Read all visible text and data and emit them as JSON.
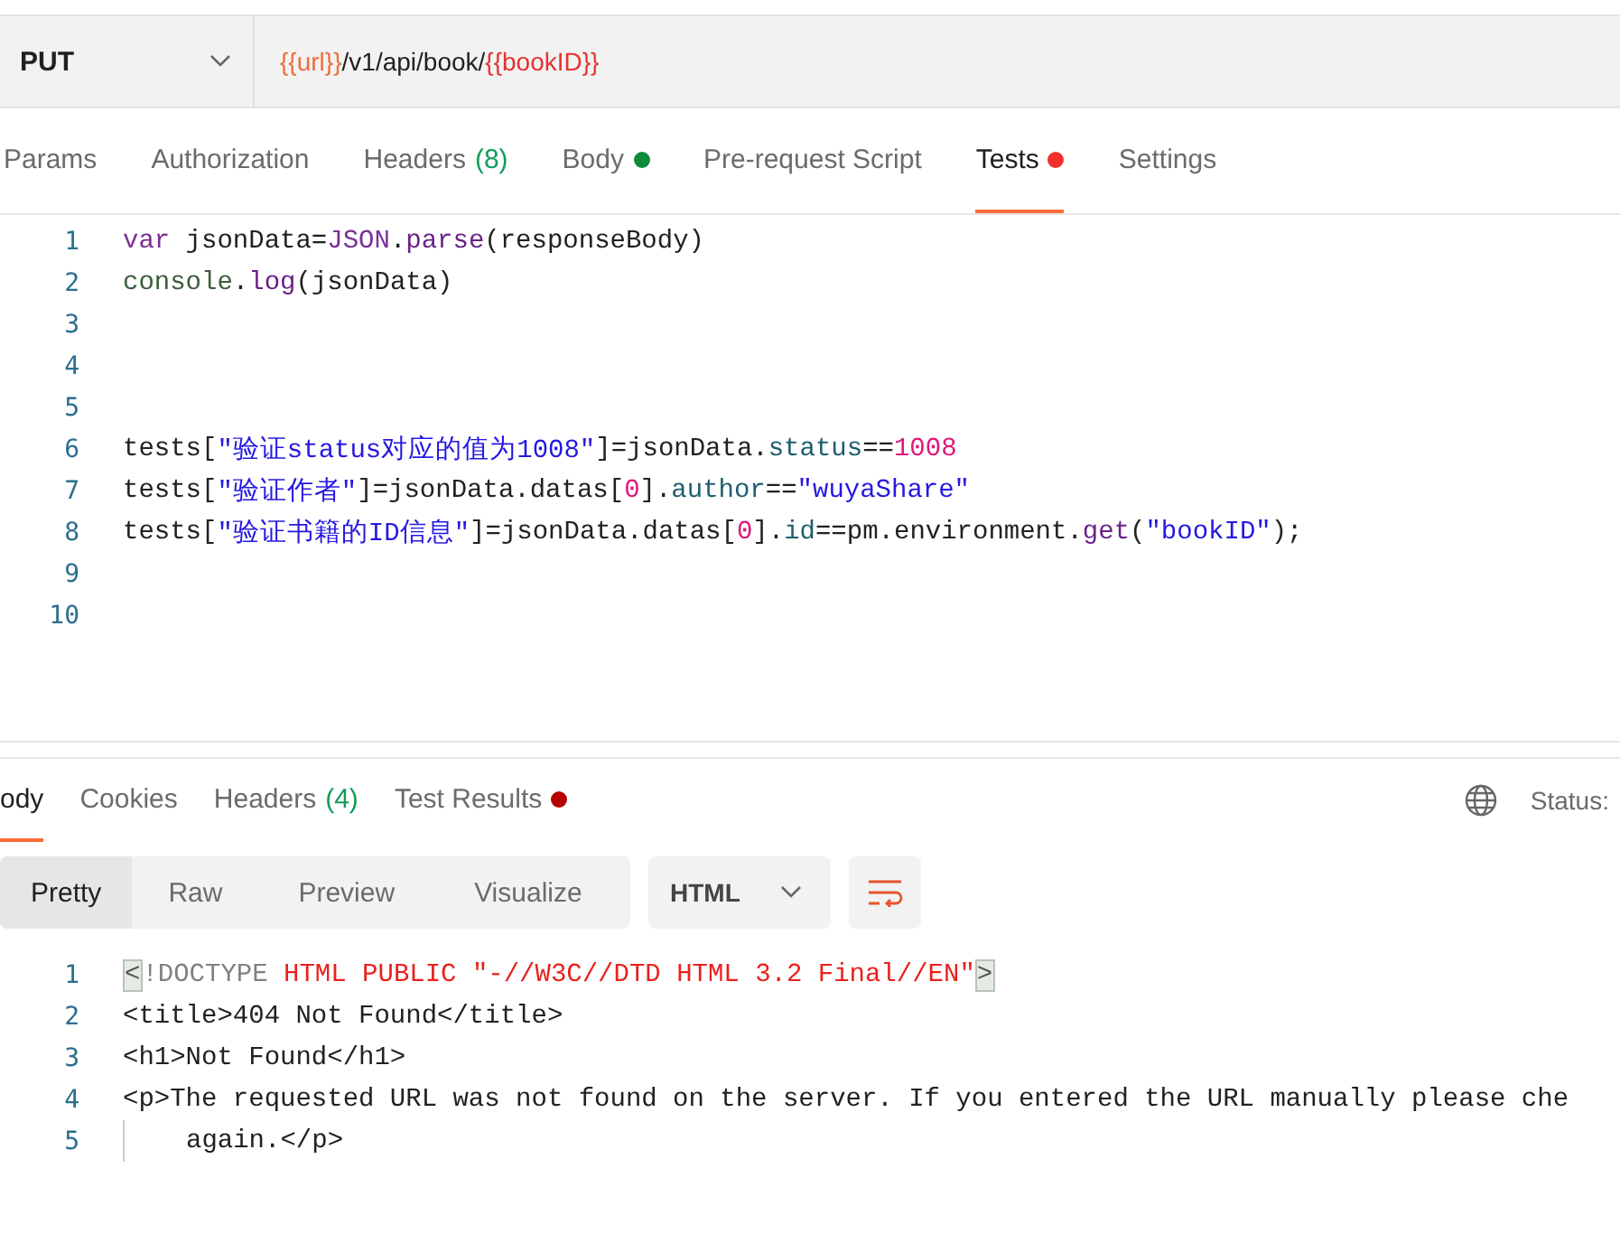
{
  "request": {
    "method": "PUT",
    "url": [
      {
        "kind": "var",
        "text": "{{url}}"
      },
      {
        "kind": "plain",
        "text": "/v1/api/book/"
      },
      {
        "kind": "var2",
        "text": "{{bookID}}"
      }
    ]
  },
  "request_tabs": [
    {
      "label": "Params",
      "selected": false
    },
    {
      "label": "Authorization",
      "selected": false
    },
    {
      "label": "Headers",
      "count": "(8)",
      "selected": false
    },
    {
      "label": "Body",
      "dot": true,
      "color": "#0f8a3c",
      "selected": false
    },
    {
      "label": "Pre-request Script",
      "selected": false
    },
    {
      "label": "Tests",
      "dot": true,
      "color": "#f0302a",
      "selected": true
    },
    {
      "label": "Settings",
      "selected": false
    }
  ],
  "script_lines": [
    {
      "number": "1",
      "tokens": [
        {
          "kind": "keyword",
          "text": "var"
        },
        {
          "kind": "plain",
          "text": " jsonData="
        },
        {
          "kind": "keyword",
          "text": "JSON"
        },
        {
          "kind": "plain",
          "text": "."
        },
        {
          "kind": "func",
          "text": "parse"
        },
        {
          "kind": "plain",
          "text": "(responseBody)"
        }
      ]
    },
    {
      "number": "2",
      "tokens": [
        {
          "kind": "object",
          "text": "console"
        },
        {
          "kind": "plain",
          "text": "."
        },
        {
          "kind": "func",
          "text": "log"
        },
        {
          "kind": "plain",
          "text": "(jsonData)"
        }
      ]
    },
    {
      "number": "3"
    },
    {
      "number": "4"
    },
    {
      "number": "5"
    },
    {
      "number": "6",
      "tokens": [
        {
          "kind": "plain",
          "text": "tests["
        },
        {
          "kind": "string",
          "text": "\"验证status对应的值为1008\""
        },
        {
          "kind": "plain",
          "text": "]=jsonData."
        },
        {
          "kind": "prop",
          "text": "status"
        },
        {
          "kind": "plain",
          "text": "=="
        },
        {
          "kind": "number",
          "text": "1008"
        }
      ]
    },
    {
      "number": "7",
      "tokens": [
        {
          "kind": "plain",
          "text": "tests["
        },
        {
          "kind": "string",
          "text": "\"验证作者\""
        },
        {
          "kind": "plain",
          "text": "]=jsonData.datas["
        },
        {
          "kind": "number",
          "text": "0"
        },
        {
          "kind": "plain",
          "text": "]."
        },
        {
          "kind": "prop",
          "text": "author"
        },
        {
          "kind": "plain",
          "text": "=="
        },
        {
          "kind": "string",
          "text": "\"wuyaShare\""
        }
      ]
    },
    {
      "number": "8",
      "tokens": [
        {
          "kind": "plain",
          "text": "tests["
        },
        {
          "kind": "string",
          "text": "\"验证书籍的ID信息\""
        },
        {
          "kind": "plain",
          "text": "]=jsonData.datas["
        },
        {
          "kind": "number",
          "text": "0"
        },
        {
          "kind": "plain",
          "text": "]."
        },
        {
          "kind": "prop",
          "text": "id"
        },
        {
          "kind": "plain",
          "text": "==pm.environment."
        },
        {
          "kind": "func",
          "text": "get"
        },
        {
          "kind": "plain",
          "text": "("
        },
        {
          "kind": "string",
          "text": "\"bookID\""
        },
        {
          "kind": "plain",
          "text": ");"
        }
      ]
    },
    {
      "number": "9"
    },
    {
      "number": "10"
    }
  ],
  "response_tabs": [
    {
      "label": "ody",
      "selected": true
    },
    {
      "label": "Cookies",
      "selected": false
    },
    {
      "label": "Headers",
      "count": "(4)",
      "selected": false
    },
    {
      "label": "Test Results",
      "dot": true,
      "color": "#b80000",
      "selected": false
    }
  ],
  "status": {
    "label": "Status:"
  },
  "view_modes": [
    {
      "label": "Pretty",
      "selected": true
    },
    {
      "label": "Raw",
      "selected": false
    },
    {
      "label": "Preview",
      "selected": false
    },
    {
      "label": "Visualize",
      "selected": false
    }
  ],
  "format": {
    "label": "HTML"
  },
  "response_lines": [
    {
      "number": "1",
      "wrapped": false,
      "tokens": [
        {
          "kind": "bracket",
          "text": "<"
        },
        {
          "kind": "doctype",
          "text": "!DOCTYPE "
        },
        {
          "kind": "attr",
          "text": "HTML PUBLIC \"-//W3C//DTD HTML 3.2 Final//EN\""
        },
        {
          "kind": "bracket",
          "text": ">"
        }
      ]
    },
    {
      "number": "2",
      "wrapped": false,
      "tokens": [
        {
          "kind": "plain",
          "text": "<title>404 Not Found</title>"
        }
      ]
    },
    {
      "number": "3",
      "wrapped": false,
      "tokens": [
        {
          "kind": "plain",
          "text": "<h1>Not Found</h1>"
        }
      ]
    },
    {
      "number": "4",
      "wrapped": false,
      "tokens": [
        {
          "kind": "plain",
          "text": "<p>The requested URL was not found on the server. If you entered the URL manually please che"
        }
      ]
    },
    {
      "number": "5",
      "wrapped": true,
      "tokens": [
        {
          "kind": "plain",
          "text": "again.</p>"
        }
      ]
    }
  ]
}
